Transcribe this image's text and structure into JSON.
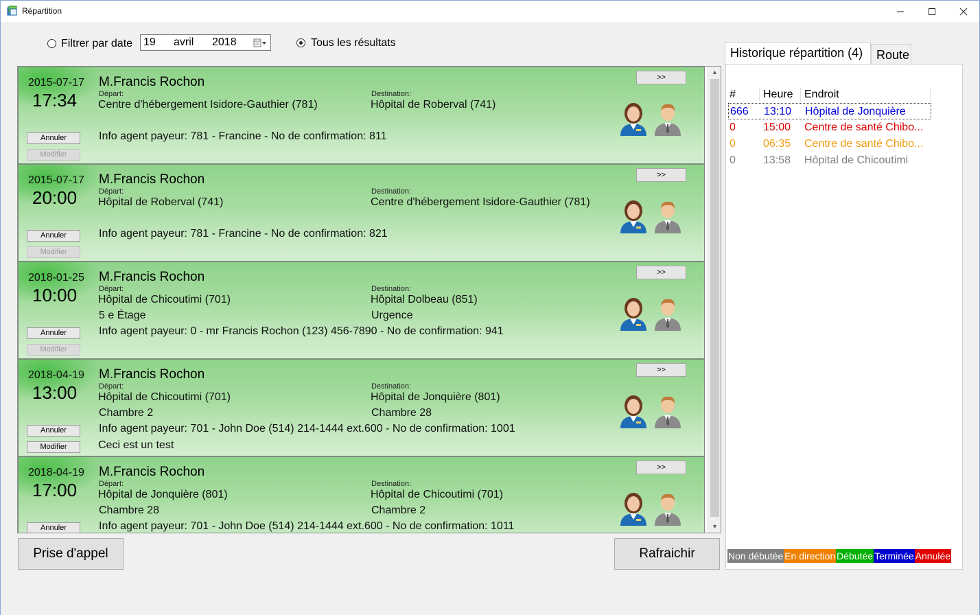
{
  "window": {
    "title": "Répartition"
  },
  "filter": {
    "by_date_label": "Filtrer par date",
    "date_day": "19",
    "date_month": "avril",
    "date_year": "2018",
    "all_results_label": "Tous les résultats",
    "selected": "all"
  },
  "labels": {
    "depart": "Départ:",
    "destination": "Destination:",
    "annuler": "Annuler",
    "modifier": "Modifier",
    "more": ">>"
  },
  "cards": [
    {
      "date": "2015-07-17",
      "time": "17:34",
      "name": "M.Francis Rochon",
      "depart": "Centre d'hébergement Isidore-Gauthier (781)",
      "depart_detail": "",
      "destination": "Hôpital de Roberval (741)",
      "destination_detail": "",
      "info": "Info agent payeur: 781 - Francine - No de confirmation: 811",
      "note": "",
      "modifier_enabled": false
    },
    {
      "date": "2015-07-17",
      "time": "20:00",
      "name": "M.Francis Rochon",
      "depart": "Hôpital de Roberval (741)",
      "depart_detail": "",
      "destination": "Centre d'hébergement Isidore-Gauthier (781)",
      "destination_detail": "",
      "info": "Info agent payeur: 781 - Francine - No de confirmation: 821",
      "note": "",
      "modifier_enabled": false
    },
    {
      "date": "2018-01-25",
      "time": "10:00",
      "name": "M.Francis Rochon",
      "depart": "Hôpital de Chicoutimi (701)",
      "depart_detail": "5 e Étage",
      "destination": "Hôpital Dolbeau (851)",
      "destination_detail": "Urgence",
      "info": "Info agent payeur: 0 - mr Francis Rochon (123) 456-7890 - No de confirmation: 941",
      "note": "",
      "modifier_enabled": false
    },
    {
      "date": "2018-04-19",
      "time": "13:00",
      "name": "M.Francis Rochon",
      "depart": "Hôpital de Chicoutimi (701)",
      "depart_detail": "Chambre 2",
      "destination": "Hôpital de Jonquière (801)",
      "destination_detail": "Chambre 28",
      "info": "Info agent payeur: 701 - John Doe (514) 214-1444 ext.600 - No de confirmation: 1001",
      "note": "Ceci est un test",
      "modifier_enabled": true
    },
    {
      "date": "2018-04-19",
      "time": "17:00",
      "name": "M.Francis Rochon",
      "depart": "Hôpital de Jonquière (801)",
      "depart_detail": "Chambre 28",
      "destination": "Hôpital de Chicoutimi (701)",
      "destination_detail": "Chambre 2",
      "info": "Info agent payeur: 701 - John Doe (514) 214-1444 ext.600 - No de confirmation: 1011",
      "note": "",
      "modifier_enabled": true
    }
  ],
  "buttons": {
    "prise_appel": "Prise d'appel",
    "rafraichir": "Rafraichir"
  },
  "tabs": {
    "historique": "Historique répartition (4)",
    "route": "Route"
  },
  "history": {
    "headers": {
      "num": "#",
      "heure": "Heure",
      "endroit": "Endroit"
    },
    "rows": [
      {
        "num": "666",
        "heure": "13:10",
        "endroit": "Hôpital de Jonquière",
        "color": "#0000e0"
      },
      {
        "num": "0",
        "heure": "15:00",
        "endroit": "Centre de santé Chibo...",
        "color": "#e00000"
      },
      {
        "num": "0",
        "heure": "06:35",
        "endroit": "Centre de santé Chibo...",
        "color": "#f39c12"
      },
      {
        "num": "0",
        "heure": "13:58",
        "endroit": "Hôpital de Chicoutimi",
        "color": "#808080"
      }
    ]
  },
  "legend": [
    {
      "label": "Non débutée",
      "color": "#808080"
    },
    {
      "label": "En direction",
      "color": "#f08000"
    },
    {
      "label": "Débutée",
      "color": "#00b000"
    },
    {
      "label": "Terminée",
      "color": "#0000d0"
    },
    {
      "label": "Annulée",
      "color": "#e00000"
    }
  ]
}
